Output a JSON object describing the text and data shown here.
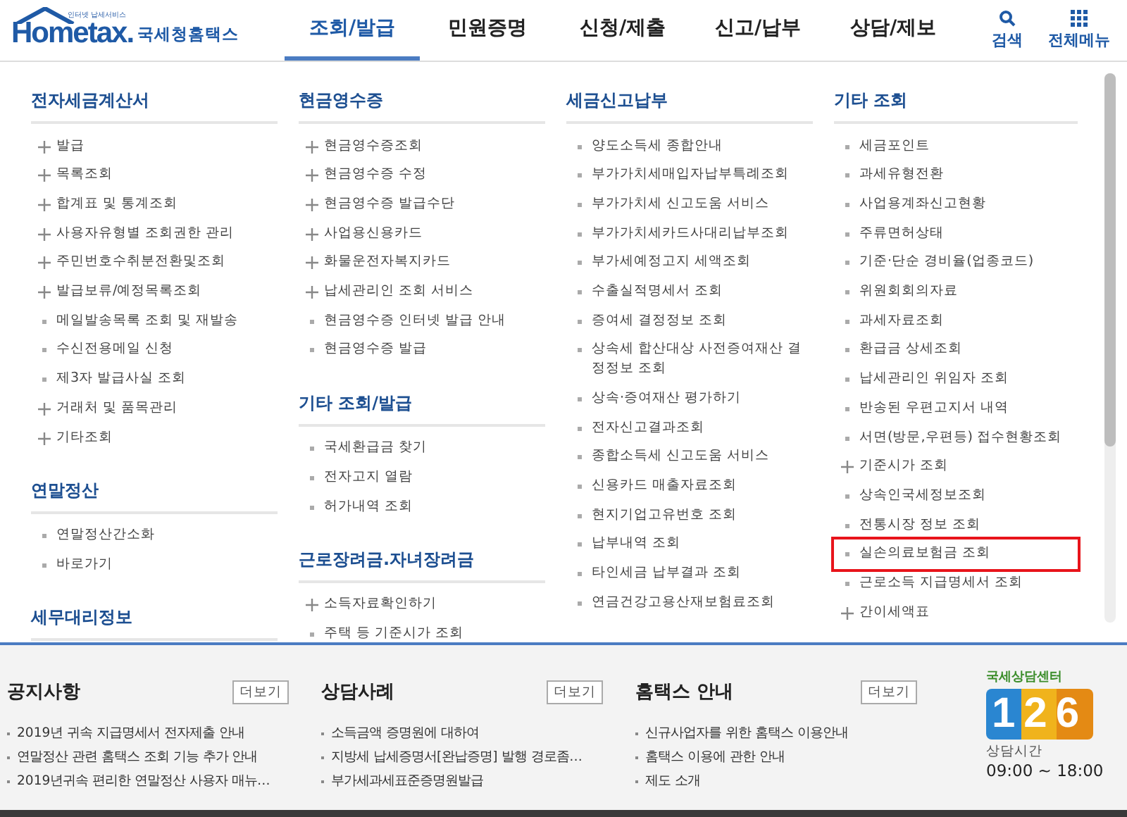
{
  "header": {
    "logo": {
      "tagline": "인터넷 납세서비스",
      "wordmark": "Hometax.",
      "name": "국세청홈택스"
    },
    "nav": [
      {
        "label": "조회/발급",
        "selected": true
      },
      {
        "label": "민원증명",
        "selected": false
      },
      {
        "label": "신청/제출",
        "selected": false
      },
      {
        "label": "신고/납부",
        "selected": false
      },
      {
        "label": "상담/제보",
        "selected": false
      }
    ],
    "tools": [
      {
        "kind": "search",
        "label": "검색"
      },
      {
        "kind": "menu",
        "label": "전체메뉴"
      }
    ]
  },
  "menu_columns": [
    {
      "sections": [
        {
          "title": "전자세금계산서",
          "items": [
            {
              "label": "발급",
              "kind": "plus",
              "highlighted": false
            },
            {
              "label": "목록조회",
              "kind": "plus",
              "highlighted": false
            },
            {
              "label": "합계표 및 통계조회",
              "kind": "plus",
              "highlighted": false
            },
            {
              "label": "사용자유형별 조회권한 관리",
              "kind": "plus",
              "highlighted": false
            },
            {
              "label": "주민번호수취분전환및조회",
              "kind": "plus",
              "highlighted": false
            },
            {
              "label": "발급보류/예정목록조회",
              "kind": "plus",
              "highlighted": false
            },
            {
              "label": "메일발송목록 조회 및 재발송",
              "kind": "dot",
              "highlighted": false
            },
            {
              "label": "수신전용메일 신청",
              "kind": "dot",
              "highlighted": false
            },
            {
              "label": "제3자 발급사실 조회",
              "kind": "dot",
              "highlighted": false
            },
            {
              "label": "거래처 및 품목관리",
              "kind": "plus",
              "highlighted": false
            },
            {
              "label": "기타조회",
              "kind": "plus",
              "highlighted": false
            }
          ]
        },
        {
          "title": "연말정산",
          "items": [
            {
              "label": "연말정산간소화",
              "kind": "dot",
              "highlighted": false
            },
            {
              "label": "바로가기",
              "kind": "dot",
              "highlighted": false
            }
          ]
        },
        {
          "title": "세무대리정보"
        }
      ]
    },
    {
      "sections": [
        {
          "title": "현금영수증",
          "items": [
            {
              "label": "현금영수증조회",
              "kind": "plus",
              "highlighted": false
            },
            {
              "label": "현금영수증 수정",
              "kind": "plus",
              "highlighted": false
            },
            {
              "label": "현금영수증 발급수단",
              "kind": "plus",
              "highlighted": false
            },
            {
              "label": "사업용신용카드",
              "kind": "plus",
              "highlighted": false
            },
            {
              "label": "화물운전자복지카드",
              "kind": "plus",
              "highlighted": false
            },
            {
              "label": "납세관리인 조회 서비스",
              "kind": "plus",
              "highlighted": false
            },
            {
              "label": "현금영수증 인터넷 발급 안내",
              "kind": "dot",
              "highlighted": false
            },
            {
              "label": "현금영수증 발급",
              "kind": "dot",
              "highlighted": false
            }
          ]
        },
        {
          "title": "기타 조회/발급",
          "items": [
            {
              "label": "국세환급금 찾기",
              "kind": "dot",
              "highlighted": false
            },
            {
              "label": "전자고지 열람",
              "kind": "dot",
              "highlighted": false
            },
            {
              "label": "허가내역 조회",
              "kind": "dot",
              "highlighted": false
            }
          ]
        },
        {
          "title": "근로장려금.자녀장려금",
          "items": [
            {
              "label": "소득자료확인하기",
              "kind": "plus",
              "highlighted": false
            },
            {
              "label": "주택 등 기준시가 조회",
              "kind": "dot",
              "highlighted": false
            }
          ]
        }
      ]
    },
    {
      "sections": [
        {
          "title": "세금신고납부",
          "items": [
            {
              "label": "양도소득세 종합안내",
              "kind": "dot",
              "highlighted": false
            },
            {
              "label": "부가가치세매입자납부특례조회",
              "kind": "dot",
              "highlighted": false
            },
            {
              "label": "부가가치세 신고도움 서비스",
              "kind": "dot",
              "highlighted": false
            },
            {
              "label": "부가가치세카드사대리납부조회",
              "kind": "dot",
              "highlighted": false
            },
            {
              "label": "부가세예정고지 세액조회",
              "kind": "dot",
              "highlighted": false
            },
            {
              "label": "수출실적명세서 조회",
              "kind": "dot",
              "highlighted": false
            },
            {
              "label": "증여세 결정정보 조회",
              "kind": "dot",
              "highlighted": false
            },
            {
              "label": "상속세 합산대상 사전증여재산 결정정보 조회",
              "kind": "dot",
              "highlighted": false
            },
            {
              "label": "상속·증여재산 평가하기",
              "kind": "dot",
              "highlighted": false
            },
            {
              "label": "전자신고결과조회",
              "kind": "dot",
              "highlighted": false
            },
            {
              "label": "종합소득세 신고도움 서비스",
              "kind": "dot",
              "highlighted": false
            },
            {
              "label": "신용카드 매출자료조회",
              "kind": "dot",
              "highlighted": false
            },
            {
              "label": "현지기업고유번호 조회",
              "kind": "dot",
              "highlighted": false
            },
            {
              "label": "납부내역 조회",
              "kind": "dot",
              "highlighted": false
            },
            {
              "label": "타인세금 납부결과 조회",
              "kind": "dot",
              "highlighted": false
            },
            {
              "label": "연금건강고용산재보험료조회",
              "kind": "dot",
              "highlighted": false
            }
          ]
        }
      ]
    },
    {
      "sections": [
        {
          "title": "기타 조회",
          "items": [
            {
              "label": "세금포인트",
              "kind": "dot",
              "highlighted": false
            },
            {
              "label": "과세유형전환",
              "kind": "dot",
              "highlighted": false
            },
            {
              "label": "사업용계좌신고현황",
              "kind": "dot",
              "highlighted": false
            },
            {
              "label": "주류면허상태",
              "kind": "dot",
              "highlighted": false
            },
            {
              "label": "기준·단순 경비율(업종코드)",
              "kind": "dot",
              "highlighted": false
            },
            {
              "label": "위원회회의자료",
              "kind": "dot",
              "highlighted": false
            },
            {
              "label": "과세자료조회",
              "kind": "dot",
              "highlighted": false
            },
            {
              "label": "환급금 상세조회",
              "kind": "dot",
              "highlighted": false
            },
            {
              "label": "납세관리인 위임자 조회",
              "kind": "dot",
              "highlighted": false
            },
            {
              "label": "반송된 우편고지서 내역",
              "kind": "dot",
              "highlighted": false
            },
            {
              "label": "서면(방문,우편등) 접수현황조회",
              "kind": "dot",
              "highlighted": false
            },
            {
              "label": "기준시가 조회",
              "kind": "plus",
              "highlighted": false
            },
            {
              "label": "상속인국세정보조회",
              "kind": "dot",
              "highlighted": false
            },
            {
              "label": "전통시장 정보 조회",
              "kind": "dot",
              "highlighted": false
            },
            {
              "label": "실손의료보험금 조회",
              "kind": "dot",
              "highlighted": true
            },
            {
              "label": "근로소득 지급명세서 조회",
              "kind": "dot",
              "highlighted": false
            },
            {
              "label": "간이세액표",
              "kind": "plus",
              "highlighted": false
            }
          ]
        }
      ]
    }
  ],
  "boards": [
    {
      "title": "공지사항",
      "more": "더보기",
      "items": [
        "2019년 귀속 지급명세서 전자제출 안내",
        "연말정산 관련 홈택스 조회 기능 추가 안내",
        "2019년귀속 편리한 연말정산 사용자 매뉴…"
      ]
    },
    {
      "title": "상담사례",
      "more": "더보기",
      "items": [
        "소득금액 증명원에 대하여",
        "지방세 납세증명서[완납증명] 발행 경로좀…",
        "부가세과세표준증명원발급"
      ]
    },
    {
      "title": "홈택스 안내",
      "more": "더보기",
      "items": [
        "신규사업자를 위한 홈택스 이용안내",
        "홈택스 이용에 관한 안내",
        "제도 소개"
      ]
    }
  ],
  "call_center": {
    "caption": "국세상담센터",
    "number": "126",
    "hours_label": "상담시간",
    "hours": "09:00 ~ 18:00"
  }
}
